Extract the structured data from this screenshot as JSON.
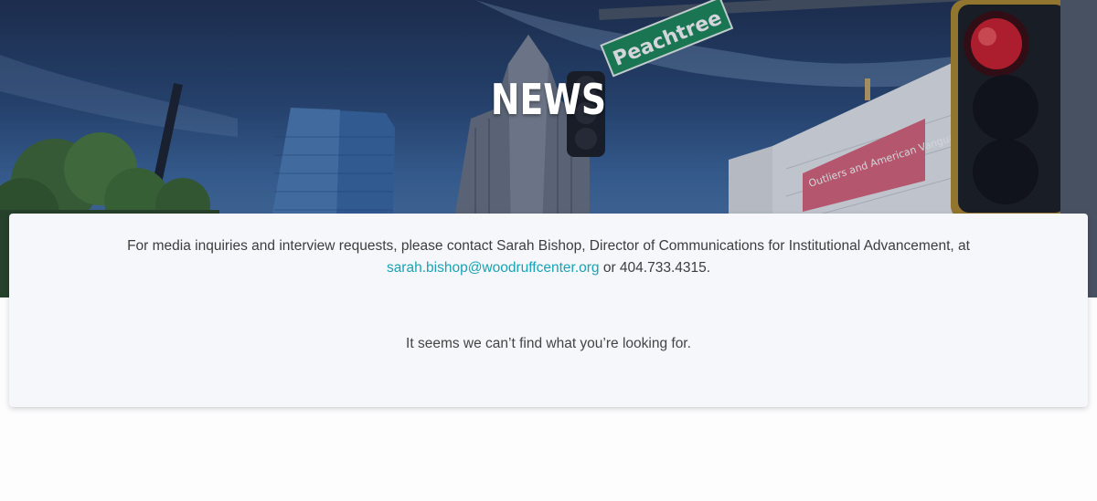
{
  "hero": {
    "title": "NEWS",
    "street_sign": "Peachtree",
    "banner_text": "Outliers and American Vanguard Art"
  },
  "notice": {
    "text_before": "For media inquiries and interview requests, please contact Sarah Bishop, Director of Communications for Institutional Advancement, at",
    "email": "sarah.bishop@woodruffcenter.org",
    "text_after": "or 404.733.4315."
  },
  "results": {
    "empty_message": "It seems we can’t find what you’re looking for."
  },
  "colors": {
    "link": "#1aa3b5",
    "card_background": "#f5f7fa",
    "sky": "#2b4a78"
  }
}
